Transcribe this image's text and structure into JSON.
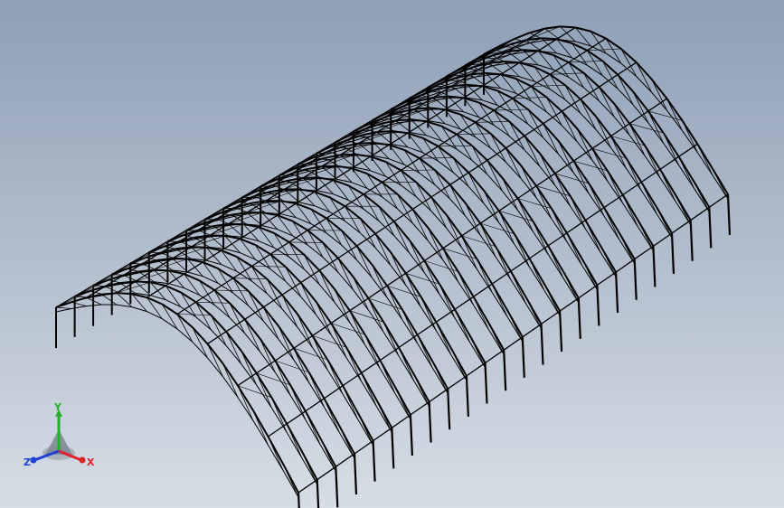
{
  "view": {
    "background_top": "#8fa0b5",
    "background_bottom": "#d6dde6",
    "model_color": "#000000",
    "model_name": "steel-arch-truss-shed"
  },
  "triad": {
    "x_label": "X",
    "y_label": "Y",
    "z_label": "Z",
    "x_color": "#e0202a",
    "y_color": "#22b02a",
    "z_color": "#1f3fd8"
  }
}
